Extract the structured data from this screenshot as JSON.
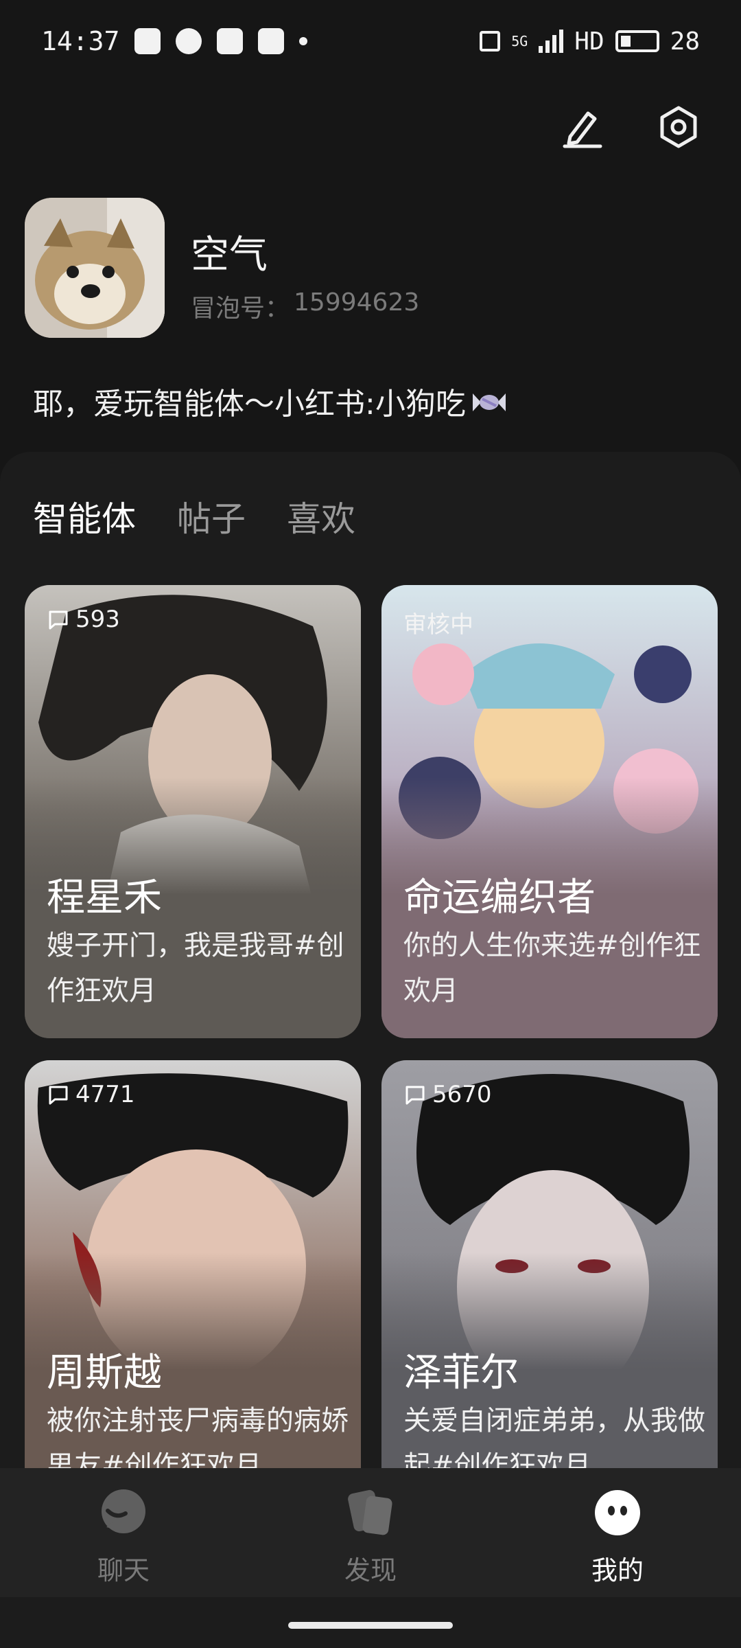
{
  "status_bar": {
    "time": "14:37",
    "network": "5G",
    "hd": "HD",
    "battery": "28"
  },
  "top_actions": {
    "edit_icon": "pencil-icon",
    "settings_icon": "hexagon-gear-icon"
  },
  "profile": {
    "name": "空气",
    "id_label": "冒泡号：",
    "id_value": "15994623",
    "bio": "耶，爱玩智能体～小红书:小狗吃"
  },
  "tabs": [
    {
      "label": "智能体",
      "active": true
    },
    {
      "label": "帖子",
      "active": false
    },
    {
      "label": "喜欢",
      "active": false
    }
  ],
  "cards": [
    {
      "badge": "593",
      "title": "程星禾",
      "desc": "嫂子开门，我是我哥#创作狂欢月",
      "color": "#5e5a55"
    },
    {
      "badge": "审核中",
      "title": "命运编织者",
      "desc": "你的人生你来选#创作狂欢月",
      "color": "#7f6b73"
    },
    {
      "badge": "4771",
      "title": "周斯越",
      "desc": "被你注射丧尸病毒的病娇男友#创作狂欢月",
      "color": "#6a5a52"
    },
    {
      "badge": "5670",
      "title": "泽菲尔",
      "desc": "关爱自闭症弟弟，从我做起#创作狂欢月",
      "color": "#5d5d62"
    }
  ],
  "bottom_nav": [
    {
      "label": "聊天",
      "icon": "chat-bubble-icon",
      "active": false
    },
    {
      "label": "发现",
      "icon": "cards-icon",
      "active": false
    },
    {
      "label": "我的",
      "icon": "face-icon",
      "active": true
    }
  ]
}
